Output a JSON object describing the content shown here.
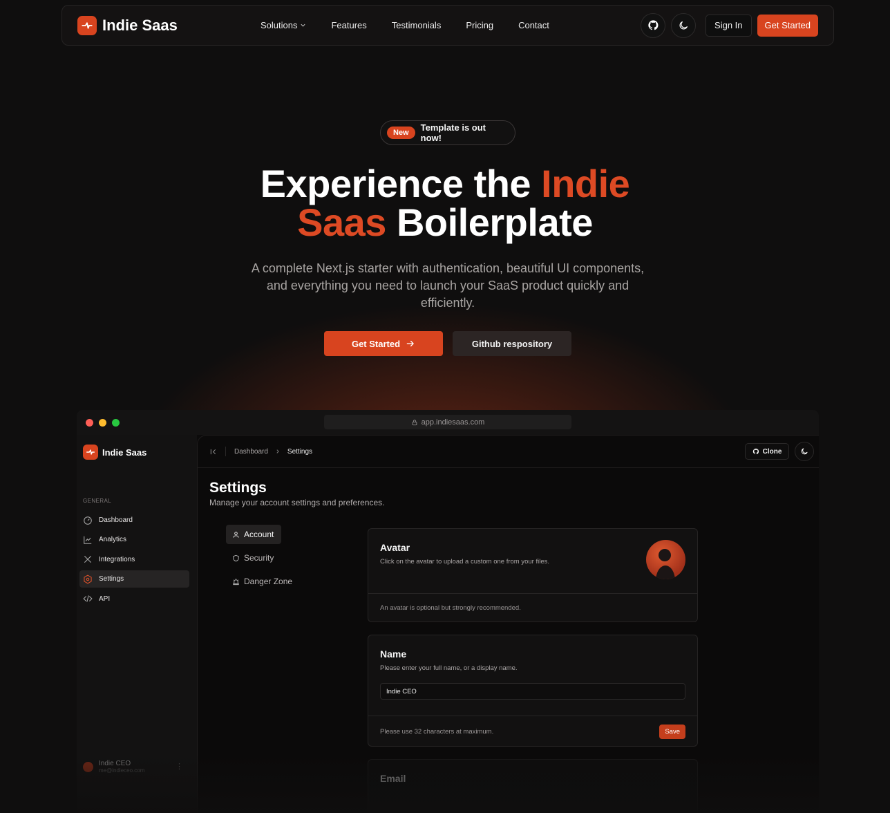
{
  "navbar": {
    "brand": "Indie Saas",
    "links": [
      "Solutions",
      "Features",
      "Testimonials",
      "Pricing",
      "Contact"
    ],
    "sign_in": "Sign In",
    "get_started": "Get Started"
  },
  "hero": {
    "badge_pill": "New",
    "badge_text": "Template is out now!",
    "headline_1": "Experience the",
    "headline_accent_1": "Indie",
    "headline_accent_2": "Saas",
    "headline_2": "Boilerplate",
    "subtitle": "A complete Next.js starter with authentication, beautiful UI components, and everything you need to launch your SaaS product quickly and efficiently.",
    "primary_button": "Get Started",
    "secondary_button": "Github respository"
  },
  "app": {
    "url": "app.indiesaas.com",
    "sidebar": {
      "brand": "Indie Saas",
      "section": "GENERAL",
      "items": [
        {
          "label": "Dashboard",
          "icon": "gauge-icon"
        },
        {
          "label": "Analytics",
          "icon": "chart-line-icon"
        },
        {
          "label": "Integrations",
          "icon": "tools-icon"
        },
        {
          "label": "Settings",
          "icon": "settings-hex-icon"
        },
        {
          "label": "API",
          "icon": "code-icon"
        }
      ],
      "user_name": "Indie CEO",
      "user_email": "me@indieceo.com"
    },
    "breadcrumb": {
      "parent": "Dashboard",
      "current": "Settings"
    },
    "clone_button": "Clone",
    "page_title": "Settings",
    "page_subtitle": "Manage your account settings and preferences.",
    "tabs": [
      "Account",
      "Security",
      "Danger Zone"
    ],
    "avatar_card": {
      "title": "Avatar",
      "description": "Click on the avatar to upload a custom one from your files.",
      "footer": "An avatar is optional but strongly recommended."
    },
    "name_card": {
      "title": "Name",
      "description": "Please enter your full name, or a display name.",
      "value": "Indie CEO",
      "footer": "Please use 32 characters at maximum.",
      "save": "Save"
    },
    "email_card": {
      "title": "Email"
    }
  },
  "colors": {
    "accent": "#d8441f",
    "background": "#0f0e0e"
  }
}
